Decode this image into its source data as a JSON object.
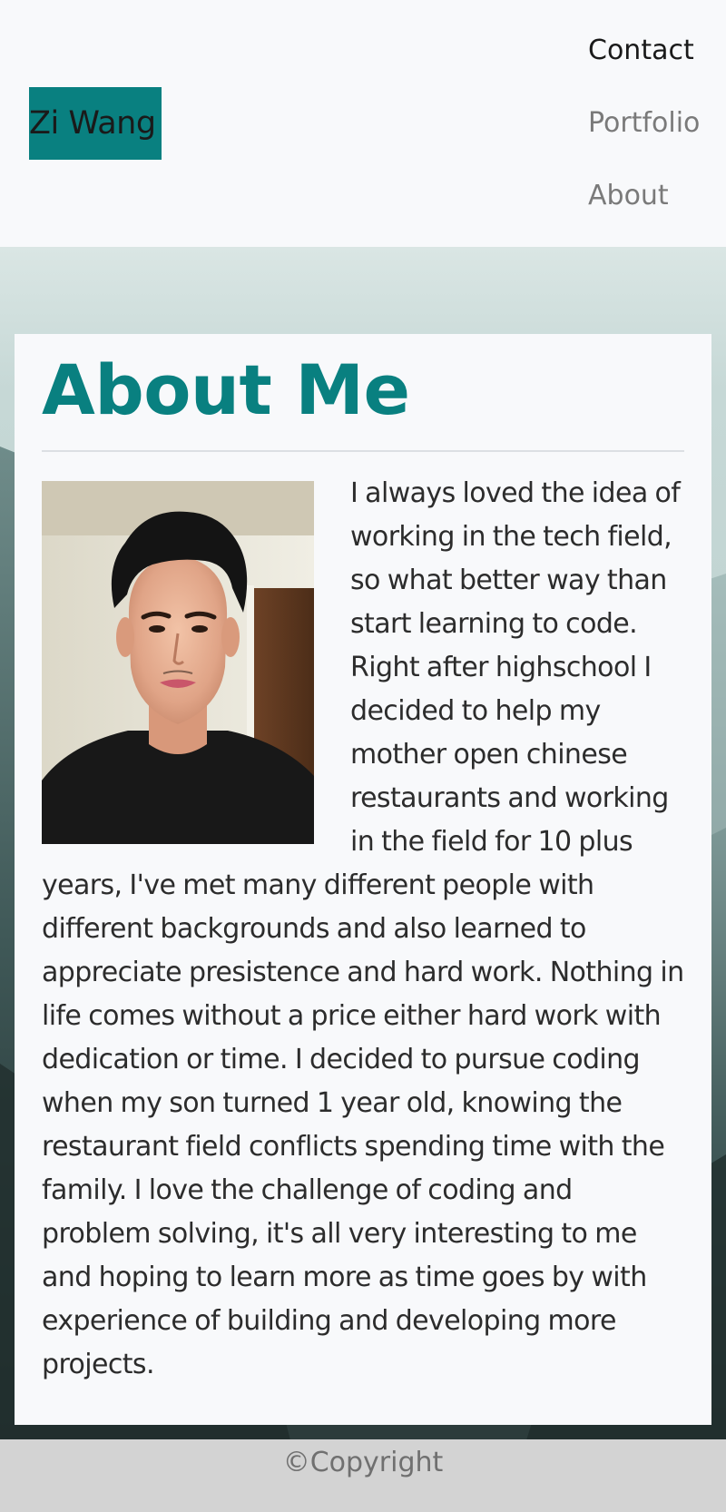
{
  "header": {
    "brand": "Zi Wang",
    "nav": [
      {
        "label": "Contact"
      },
      {
        "label": "Portfolio"
      },
      {
        "label": "About"
      }
    ]
  },
  "about": {
    "title": "About Me",
    "bio": "I always loved the idea of working in the tech field, so what better way than start learning to code. Right after highschool I decided to help my mother open chinese restaurants and working in the field for 10 plus years, I've met many different people with different backgrounds and also learned to appreciate presistence and hard work. Nothing in life comes without a price either hard work with dedication or time. I decided to pursue coding when my son turned 1 year old, knowing the restaurant field conflicts spending time with the family. I love the challenge of coding and problem solving, it's all very interesting to me and hoping to learn more as time goes by with experience of building and developing more projects."
  },
  "footer": {
    "copyright": "©Copyright"
  },
  "colors": {
    "accent": "#098080",
    "page_background": "#f8f9fb",
    "footer_background": "#d3d3d3"
  },
  "icons": {
    "profile_photo": "portrait-photo"
  }
}
